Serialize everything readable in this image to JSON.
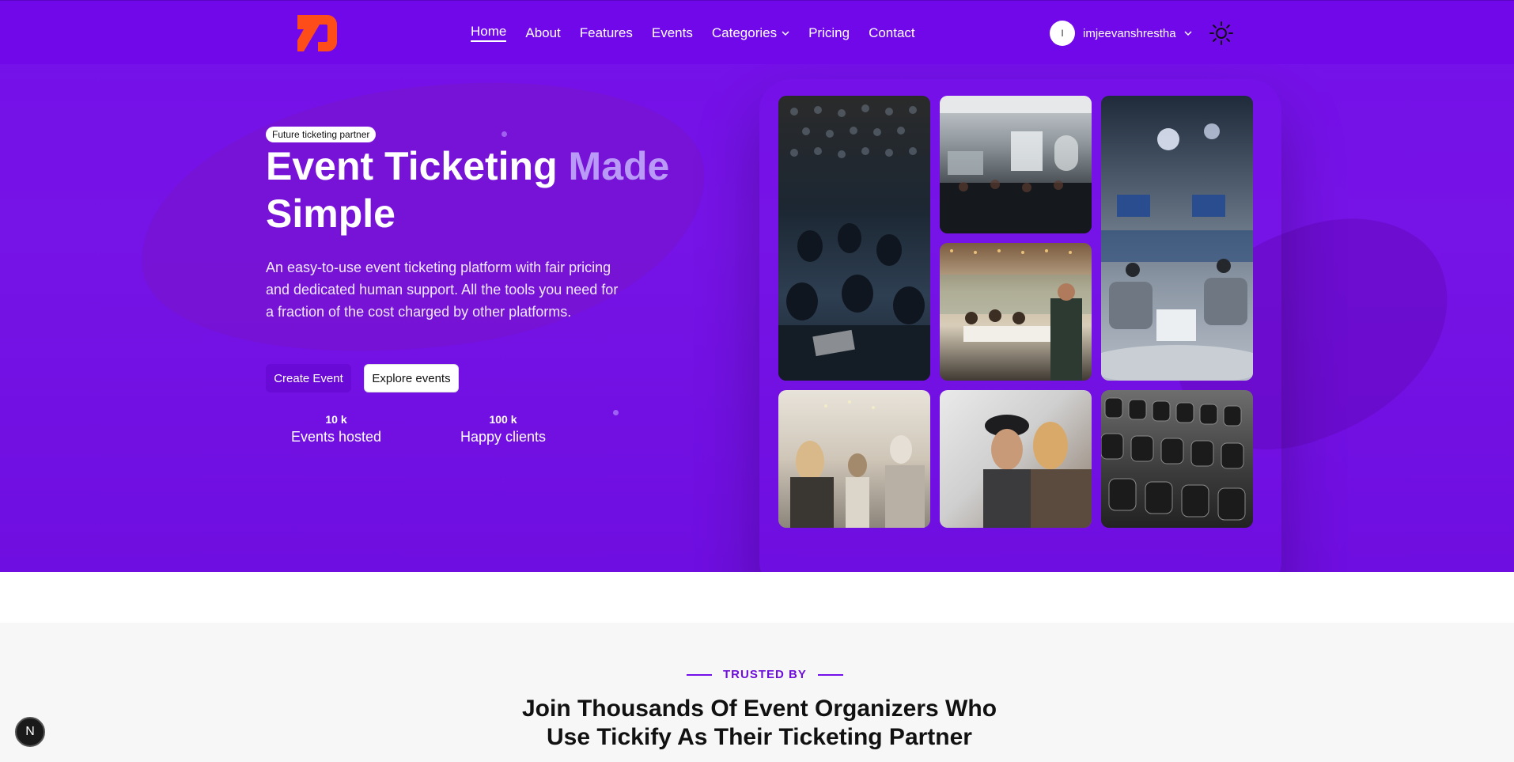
{
  "nav": {
    "items": [
      {
        "label": "Home",
        "active": true
      },
      {
        "label": "About"
      },
      {
        "label": "Features"
      },
      {
        "label": "Events"
      },
      {
        "label": "Categories",
        "dropdown": true
      },
      {
        "label": "Pricing"
      },
      {
        "label": "Contact"
      }
    ],
    "user": {
      "initial": "I",
      "name": "imjeevanshrestha"
    },
    "logo_color": "#ff4d1a"
  },
  "hero": {
    "badge": "Future ticketing partner",
    "title_part1": "Event Ticketing",
    "title_fade": "Made",
    "title_part2": "Simple",
    "description": "An easy-to-use event ticketing platform with fair pricing and dedicated human support. All the tools you need for a fraction of the cost charged by other platforms.",
    "create_button": "Create Event",
    "explore_button": "Explore events",
    "stats": [
      {
        "value": "10 k",
        "label": "Events hosted"
      },
      {
        "value": "100 k",
        "label": "Happy clients"
      }
    ]
  },
  "trusted": {
    "label": "TRUSTED BY",
    "heading_line1": "Join Thousands Of Event Organizers Who",
    "heading_line2": "Use Tickify As Their Ticketing Partner"
  },
  "dev_badge": "N",
  "colors": {
    "primary": "#7410ea",
    "accent": "#ff4d1a"
  }
}
